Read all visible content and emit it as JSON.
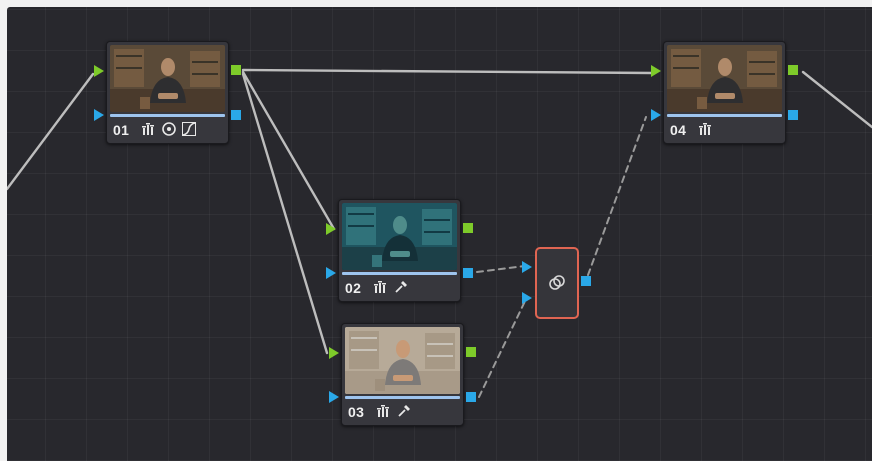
{
  "colors": {
    "background": "#28282d",
    "node": "#37373d",
    "rgb_port": "#7ecb2a",
    "alpha_port": "#2aa8e8",
    "rgb_wire": "#bdbdbd",
    "dashed_wire": "#9a9a9a",
    "selected_outline": "#e06552",
    "thumb_accent": "#9ec4ee"
  },
  "nodes": [
    {
      "label": "01",
      "tools": [
        "qualifier-icon",
        "window-icon",
        "curves-icon"
      ],
      "look": "original"
    },
    {
      "label": "02",
      "tools": [
        "qualifier-icon",
        "eyedropper-icon"
      ],
      "look": "teal"
    },
    {
      "label": "03",
      "tools": [
        "qualifier-icon",
        "eyedropper-icon"
      ],
      "look": "warm-bright"
    },
    {
      "label": "04",
      "tools": [
        "qualifier-icon"
      ],
      "look": "original"
    }
  ],
  "layer_mixer": {
    "icon": "layer-mixer-icon",
    "selected": true
  },
  "connections": [
    {
      "from": "input",
      "to": "01",
      "type": "rgb"
    },
    {
      "from": "01",
      "to": "04",
      "type": "rgb"
    },
    {
      "from": "01",
      "to": "02",
      "type": "rgb"
    },
    {
      "from": "01",
      "to": "03",
      "type": "rgb"
    },
    {
      "from": "02",
      "to": "layer_mixer",
      "type": "dashed"
    },
    {
      "from": "03",
      "to": "layer_mixer",
      "type": "dashed"
    },
    {
      "from": "layer_mixer",
      "to": "04",
      "type": "dashed"
    },
    {
      "from": "04",
      "to": "output",
      "type": "rgb"
    }
  ]
}
